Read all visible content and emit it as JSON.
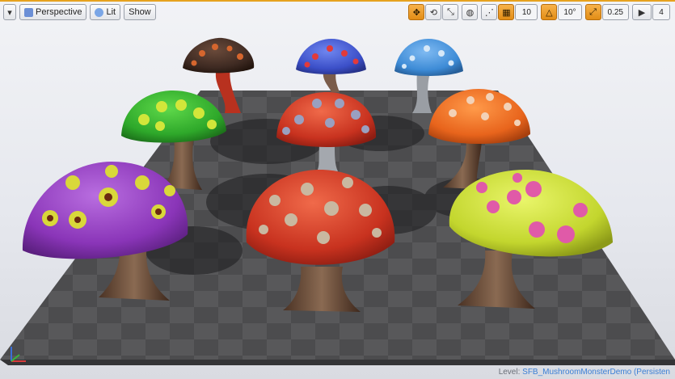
{
  "toolbar": {
    "menu_icon": "dropdown-triangle-icon",
    "perspective_label": "Perspective",
    "lit_label": "Lit",
    "show_label": "Show",
    "grid_snap_value": "10",
    "rotation_snap_value": "10°",
    "scale_snap_value": "0.25",
    "camera_speed_value": "4"
  },
  "status": {
    "level_prefix": "Level:",
    "level_name": "SFB_MushroomMonsterDemo (Persisten"
  },
  "colors": {
    "accent": "#e7a21f",
    "active_button": "#e28d16",
    "level_link": "#3a7fd6"
  }
}
